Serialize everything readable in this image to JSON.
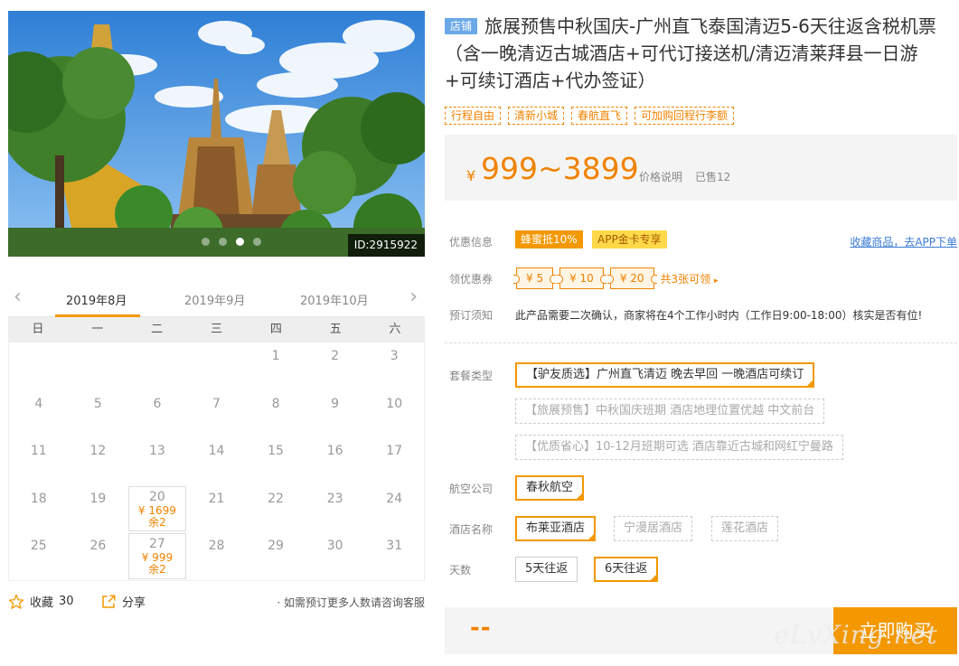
{
  "hero": {
    "id_label": "ID:2915922",
    "dots": 4,
    "active_dot": 3
  },
  "calendar": {
    "months": [
      "2019年8月",
      "2019年9月",
      "2019年10月"
    ],
    "active_month": 0,
    "weekdays": [
      "日",
      "一",
      "二",
      "三",
      "四",
      "五",
      "六"
    ],
    "leading_blanks": 4,
    "days_in_month": 31,
    "availability": [
      {
        "day": 20,
        "price": "¥ 1699",
        "remaining": "余2"
      },
      {
        "day": 27,
        "price": "¥ 999",
        "remaining": "余2"
      }
    ]
  },
  "bottom": {
    "favorite_label": "收藏",
    "favorite_count": "30",
    "share_label": "分享",
    "hint": "· 如需预订更多人数请咨询客服"
  },
  "product": {
    "shop_badge": "店铺",
    "title": "旅展预售中秋国庆-广州直飞泰国清迈5-6天往返含税机票（含一晚清迈古城酒店+可代订接送机/清迈清莱拜县一日游+可续订酒店+代办签证）",
    "tags": [
      "行程自由",
      "清新小城",
      "春航直飞",
      "可加购回程行李额"
    ]
  },
  "price": {
    "currency": "¥",
    "range": "999~3899",
    "explain_label": "价格说明",
    "sold": "已售12"
  },
  "discount": {
    "label": "优惠信息",
    "badge1": "蜂蜜抵10%",
    "badge2": "APP金卡专享",
    "link": "收藏商品，去APP下单"
  },
  "coupons": {
    "label": "领优惠券",
    "items": [
      "¥ 5",
      "¥ 10",
      "¥ 20"
    ],
    "more": "共3张可领"
  },
  "notice": {
    "label": "预订须知",
    "text": "此产品需要二次确认，商家将在4个工作小时内（工作日9:00-18:00）核实是否有位!"
  },
  "package": {
    "label": "套餐类型",
    "options": [
      "【驴友质选】广州直飞清迈 晚去早回 一晚酒店可续订",
      "【旅展预售】中秋国庆班期 酒店地理位置优越 中文前台",
      "【优质省心】10-12月班期可选 酒店靠近古城和网红宁曼路"
    ],
    "selected": 0
  },
  "airline": {
    "label": "航空公司",
    "options": [
      "春秋航空"
    ],
    "selected": 0
  },
  "hotel": {
    "label": "酒店名称",
    "options": [
      "布莱亚酒店",
      "宁漫居酒店",
      "莲花酒店"
    ],
    "selected": 0
  },
  "days": {
    "label": "天数",
    "options": [
      "5天往返",
      "6天往返"
    ],
    "selected": 1
  },
  "buy": {
    "price_placeholder": "--",
    "button": "立即购买"
  },
  "watermark": "eLvXing.net",
  "colors": {
    "accent": "#f39800",
    "price": "#f08200",
    "link": "#3a7bd5",
    "shop_badge": "#6aa8e8"
  }
}
